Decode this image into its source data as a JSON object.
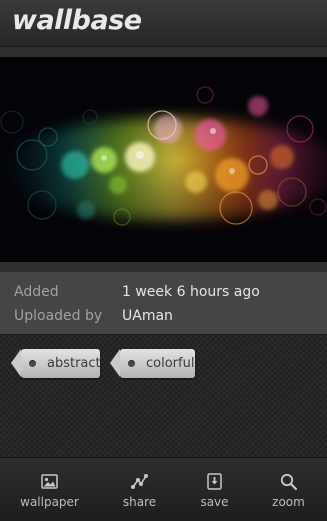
{
  "app": {
    "title": "wallbase"
  },
  "info": {
    "added_label": "Added",
    "added_value": "1 week  6 hours ago",
    "uploader_label": "Uploaded by",
    "uploader_value": "UAman"
  },
  "tags": [
    {
      "label": "abstract"
    },
    {
      "label": "colorful"
    }
  ],
  "bottom_nav": [
    {
      "label": "wallpaper",
      "icon": "image-icon"
    },
    {
      "label": "share",
      "icon": "share-icon"
    },
    {
      "label": "save",
      "icon": "save-icon"
    },
    {
      "label": "zoom",
      "icon": "zoom-icon"
    }
  ],
  "colors": {
    "background": "#2f2f2f",
    "info_panel": "#454545",
    "tag": "#d0d0d0",
    "bar": "#262626"
  }
}
